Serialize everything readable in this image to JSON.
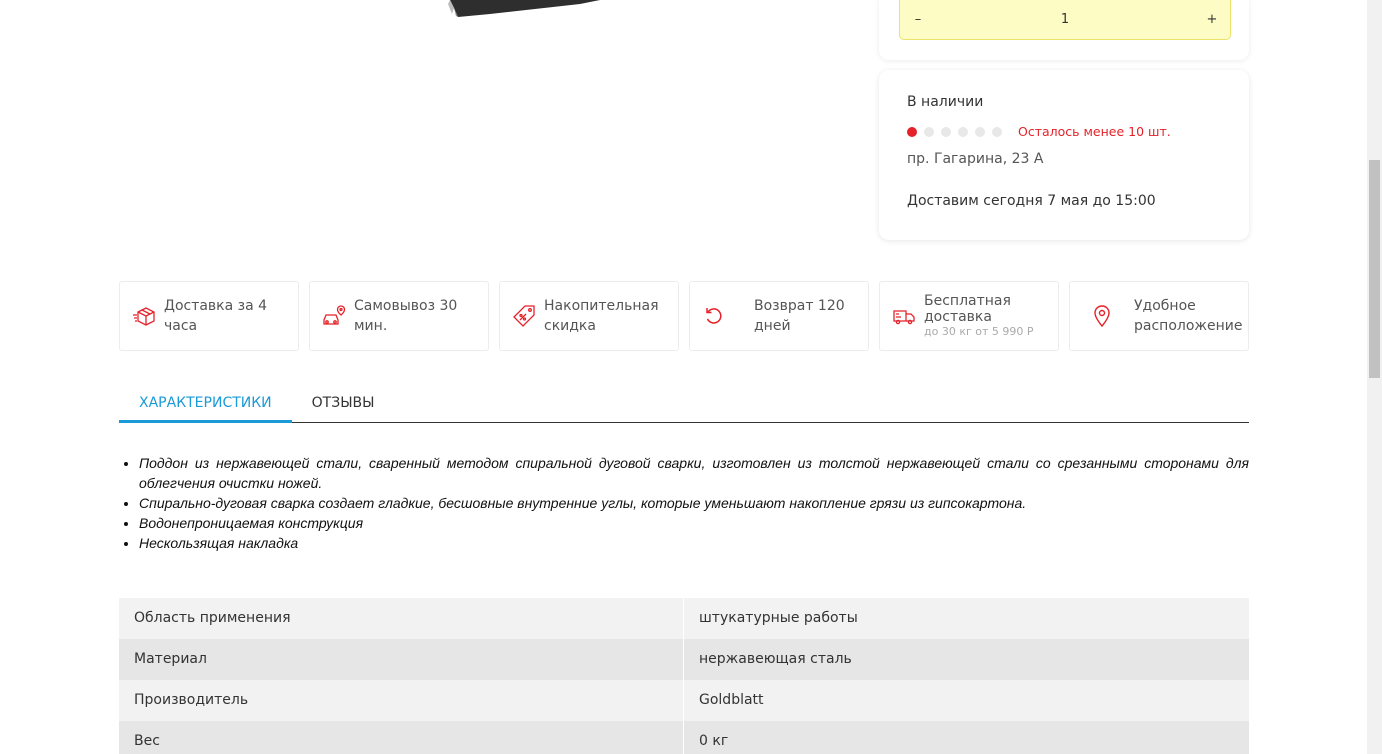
{
  "quantity": {
    "minus": "–",
    "value": "1",
    "plus": "+"
  },
  "availability": {
    "title": "В наличии",
    "stock_level": 1,
    "stock_dots": 6,
    "stock_text": "Осталось менее 10 шт.",
    "address": "пр. Гагарина, 23 А",
    "delivery": "Доставим сегодня 7 мая до 15:00",
    "accent": "#e52229"
  },
  "features": [
    {
      "icon": "box-icon",
      "label": "Доставка за 4 часа"
    },
    {
      "icon": "car-pin-icon",
      "label": "Самовывоз 30 мин."
    },
    {
      "icon": "discount-tag-icon",
      "label": "Накопительная скидка"
    },
    {
      "icon": "return-icon",
      "label": "Возврат 120 дней"
    },
    {
      "icon": "truck-icon",
      "label": "Бесплатная доставка",
      "sub": "до 30 кг от 5 990 Р"
    },
    {
      "icon": "location-pin-icon",
      "label": "Удобное расположение"
    }
  ],
  "tabs": [
    {
      "label": "ХАРАКТЕРИСТИКИ",
      "active": true
    },
    {
      "label": "ОТЗЫВЫ",
      "active": false
    }
  ],
  "description": [
    "Поддон из нержавеющей стали, сваренный методом спиральной дуговой сварки, изготовлен из толстой нержавеющей стали со срезанными сторонами для облегчения очистки ножей.",
    "Спирально-дуговая сварка создает гладкие, бесшовные внутренние углы, которые уменьшают накопление грязи из гипсокартона.",
    "Водонепроницаемая конструкция",
    "Нескользящая накладка"
  ],
  "specs": [
    {
      "key": "Область применения",
      "value": "штукатурные работы"
    },
    {
      "key": "Материал",
      "value": "нержавеющая сталь"
    },
    {
      "key": "Производитель",
      "value": "Goldblatt"
    },
    {
      "key": "Вес",
      "value": "0 кг"
    }
  ],
  "colors": {
    "tab_active": "#1a9ad6",
    "qty_bg": "#fdfcc4",
    "icon": "#e52229"
  }
}
